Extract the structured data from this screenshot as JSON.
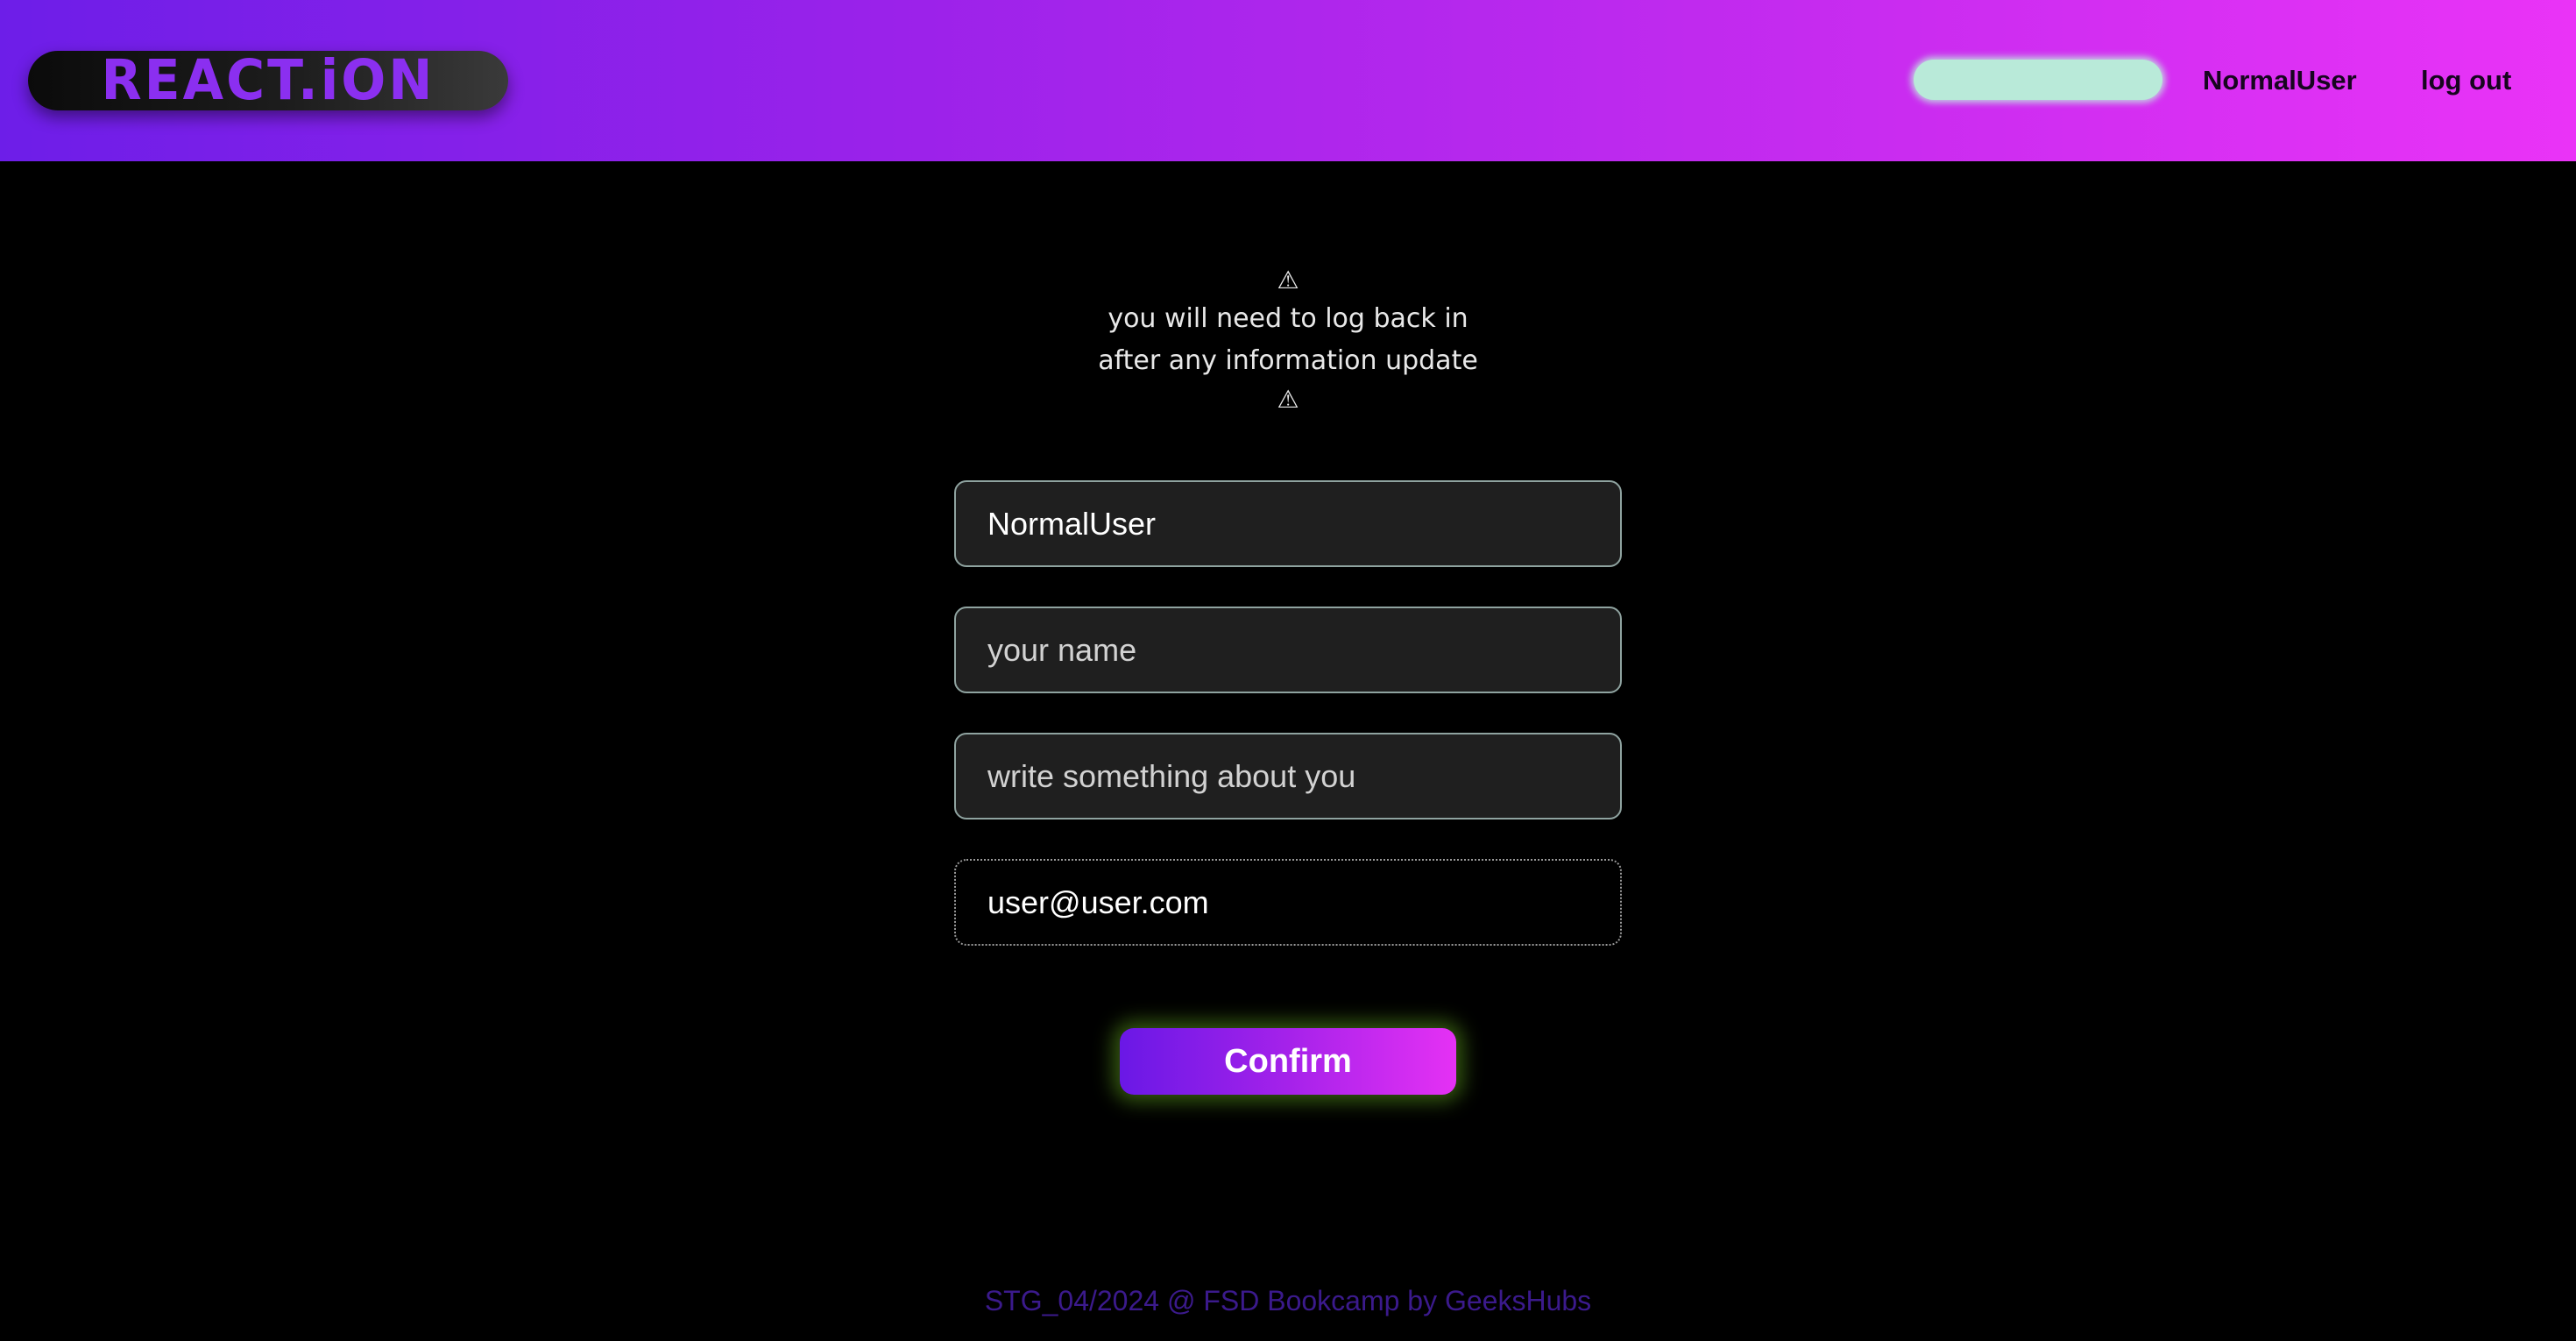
{
  "header": {
    "logo_text": "REACT.iON",
    "nav": {
      "username": "NormalUser",
      "logout_label": "log out"
    }
  },
  "notice": {
    "warning_icon": "⚠",
    "line1": "you will need to log back in",
    "line2": "after any information update"
  },
  "form": {
    "username_value": "NormalUser",
    "name_placeholder": "your name",
    "about_placeholder": "write something about you",
    "email_value": "user@user.com",
    "confirm_label": "Confirm"
  },
  "footer": {
    "text": "STG_04/2024 @ FSD Bookcamp by GeeksHubs"
  },
  "colors": {
    "header_gradient_start": "#6d1ee8",
    "header_gradient_end": "#ea33f7",
    "logo_text": "#8b2ff0",
    "search_pill": "#b9ead9",
    "button_glow": "#5fa01e",
    "footer_text": "#3b1a8c"
  }
}
